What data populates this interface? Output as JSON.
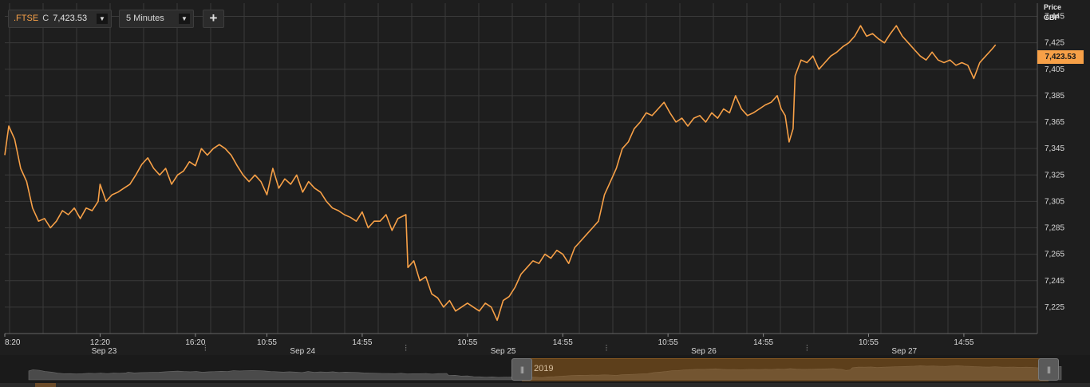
{
  "toolbar": {
    "ticker_symbol": ".FTSE",
    "ticker_flag": "C",
    "ticker_value": "7,423.53",
    "interval_label": "5 Minutes",
    "add_label": "+",
    "dropdown_glyph": "▼"
  },
  "axis_header": {
    "price_label": "Price",
    "currency_label": "GBP"
  },
  "last_price_label": "7,423.53",
  "navigator": {
    "year_label": "2019",
    "handle_glyph": "|||"
  },
  "colors": {
    "line": "#f7a047",
    "background": "#1e1e1e",
    "grid": "#3a3a3a",
    "accent": "#f7a047"
  },
  "chart_data": {
    "type": "line",
    "title": "",
    "xlabel": "",
    "ylabel": "Price GBP",
    "ylim": [
      7205,
      7455
    ],
    "yticks": [
      7225,
      7245,
      7265,
      7285,
      7305,
      7325,
      7345,
      7365,
      7385,
      7405,
      7425,
      7445
    ],
    "ytick_labels": [
      "7,225",
      "7,245",
      "7,265",
      "7,285",
      "7,305",
      "7,325",
      "7,345",
      "7,365",
      "7,385",
      "7,405",
      "7,425",
      "7,445"
    ],
    "grid": true,
    "legend": "none",
    "last_value": 7423.53,
    "x_time_labels": [
      {
        "index": 0,
        "label": "8:20"
      },
      {
        "index": 48,
        "label": "12:20"
      },
      {
        "index": 96,
        "label": "16:20"
      },
      {
        "index": 132,
        "label": "10:55"
      },
      {
        "index": 180,
        "label": "14:55"
      },
      {
        "index": 233,
        "label": "10:55"
      },
      {
        "index": 281,
        "label": "14:55"
      },
      {
        "index": 334,
        "label": "10:55"
      },
      {
        "index": 382,
        "label": "14:55"
      },
      {
        "index": 435,
        "label": "10:55"
      },
      {
        "index": 483,
        "label": "14:55"
      }
    ],
    "x_date_labels": [
      {
        "index": 50,
        "label": "Sep 23"
      },
      {
        "index": 150,
        "label": "Sep 24"
      },
      {
        "index": 251,
        "label": "Sep 25"
      },
      {
        "index": 352,
        "label": "Sep 26"
      },
      {
        "index": 453,
        "label": "Sep 27"
      }
    ],
    "session_breaks": [
      101,
      202,
      303,
      404
    ],
    "series": [
      {
        "values": [
          [
            0,
            7340
          ],
          [
            2,
            7362
          ],
          [
            5,
            7352
          ],
          [
            8,
            7330
          ],
          [
            11,
            7320
          ],
          [
            14,
            7300
          ],
          [
            17,
            7290
          ],
          [
            20,
            7292
          ],
          [
            23,
            7285
          ],
          [
            26,
            7290
          ],
          [
            29,
            7298
          ],
          [
            32,
            7295
          ],
          [
            35,
            7300
          ],
          [
            38,
            7292
          ],
          [
            41,
            7300
          ],
          [
            44,
            7298
          ],
          [
            47,
            7305
          ],
          [
            48,
            7318
          ],
          [
            51,
            7305
          ],
          [
            54,
            7310
          ],
          [
            57,
            7312
          ],
          [
            60,
            7315
          ],
          [
            63,
            7318
          ],
          [
            66,
            7325
          ],
          [
            69,
            7333
          ],
          [
            72,
            7338
          ],
          [
            75,
            7330
          ],
          [
            78,
            7325
          ],
          [
            81,
            7330
          ],
          [
            84,
            7318
          ],
          [
            87,
            7325
          ],
          [
            90,
            7328
          ],
          [
            93,
            7335
          ],
          [
            96,
            7332
          ],
          [
            99,
            7345
          ],
          [
            102,
            7340
          ],
          [
            105,
            7345
          ],
          [
            108,
            7348
          ],
          [
            111,
            7345
          ],
          [
            114,
            7340
          ],
          [
            117,
            7332
          ],
          [
            120,
            7325
          ],
          [
            123,
            7320
          ],
          [
            126,
            7325
          ],
          [
            129,
            7320
          ],
          [
            132,
            7310
          ],
          [
            135,
            7330
          ],
          [
            138,
            7315
          ],
          [
            141,
            7322
          ],
          [
            144,
            7318
          ],
          [
            147,
            7325
          ],
          [
            150,
            7312
          ],
          [
            153,
            7320
          ],
          [
            156,
            7315
          ],
          [
            159,
            7312
          ],
          [
            162,
            7305
          ],
          [
            165,
            7300
          ],
          [
            168,
            7298
          ],
          [
            171,
            7295
          ],
          [
            174,
            7293
          ],
          [
            177,
            7290
          ],
          [
            180,
            7297
          ],
          [
            183,
            7285
          ],
          [
            186,
            7290
          ],
          [
            189,
            7290
          ],
          [
            192,
            7295
          ],
          [
            195,
            7283
          ],
          [
            198,
            7292
          ],
          [
            202,
            7295
          ],
          [
            203,
            7255
          ],
          [
            206,
            7260
          ],
          [
            209,
            7245
          ],
          [
            212,
            7248
          ],
          [
            215,
            7235
          ],
          [
            218,
            7232
          ],
          [
            221,
            7225
          ],
          [
            224,
            7230
          ],
          [
            227,
            7222
          ],
          [
            230,
            7225
          ],
          [
            233,
            7228
          ],
          [
            236,
            7225
          ],
          [
            239,
            7222
          ],
          [
            242,
            7228
          ],
          [
            245,
            7225
          ],
          [
            248,
            7215
          ],
          [
            251,
            7230
          ],
          [
            254,
            7233
          ],
          [
            257,
            7240
          ],
          [
            260,
            7250
          ],
          [
            263,
            7255
          ],
          [
            266,
            7260
          ],
          [
            269,
            7258
          ],
          [
            272,
            7265
          ],
          [
            275,
            7262
          ],
          [
            278,
            7268
          ],
          [
            281,
            7265
          ],
          [
            284,
            7258
          ],
          [
            287,
            7270
          ],
          [
            290,
            7275
          ],
          [
            293,
            7280
          ],
          [
            296,
            7285
          ],
          [
            299,
            7290
          ],
          [
            302,
            7310
          ],
          [
            305,
            7320
          ],
          [
            308,
            7330
          ],
          [
            311,
            7345
          ],
          [
            314,
            7350
          ],
          [
            317,
            7360
          ],
          [
            320,
            7365
          ],
          [
            323,
            7372
          ],
          [
            326,
            7370
          ],
          [
            329,
            7375
          ],
          [
            332,
            7380
          ],
          [
            335,
            7372
          ],
          [
            338,
            7365
          ],
          [
            341,
            7368
          ],
          [
            344,
            7362
          ],
          [
            347,
            7368
          ],
          [
            350,
            7370
          ],
          [
            353,
            7365
          ],
          [
            356,
            7372
          ],
          [
            359,
            7368
          ],
          [
            362,
            7375
          ],
          [
            365,
            7372
          ],
          [
            368,
            7385
          ],
          [
            371,
            7375
          ],
          [
            374,
            7370
          ],
          [
            377,
            7372
          ],
          [
            380,
            7375
          ],
          [
            383,
            7378
          ],
          [
            386,
            7380
          ],
          [
            389,
            7385
          ],
          [
            391,
            7375
          ],
          [
            393,
            7370
          ],
          [
            395,
            7350
          ],
          [
            397,
            7360
          ],
          [
            398,
            7400
          ],
          [
            401,
            7412
          ],
          [
            404,
            7410
          ],
          [
            407,
            7415
          ],
          [
            410,
            7405
          ],
          [
            413,
            7410
          ],
          [
            416,
            7415
          ],
          [
            419,
            7418
          ],
          [
            422,
            7422
          ],
          [
            425,
            7425
          ],
          [
            428,
            7430
          ],
          [
            431,
            7438
          ],
          [
            434,
            7430
          ],
          [
            437,
            7432
          ],
          [
            440,
            7428
          ],
          [
            443,
            7425
          ],
          [
            446,
            7432
          ],
          [
            449,
            7438
          ],
          [
            452,
            7430
          ],
          [
            455,
            7425
          ],
          [
            458,
            7420
          ],
          [
            461,
            7415
          ],
          [
            464,
            7412
          ],
          [
            467,
            7418
          ],
          [
            470,
            7412
          ],
          [
            473,
            7410
          ],
          [
            476,
            7412
          ],
          [
            479,
            7408
          ],
          [
            482,
            7410
          ],
          [
            485,
            7408
          ],
          [
            488,
            7398
          ],
          [
            491,
            7410
          ],
          [
            494,
            7415
          ],
          [
            497,
            7420
          ],
          [
            499,
            7423.53
          ]
        ]
      }
    ]
  }
}
